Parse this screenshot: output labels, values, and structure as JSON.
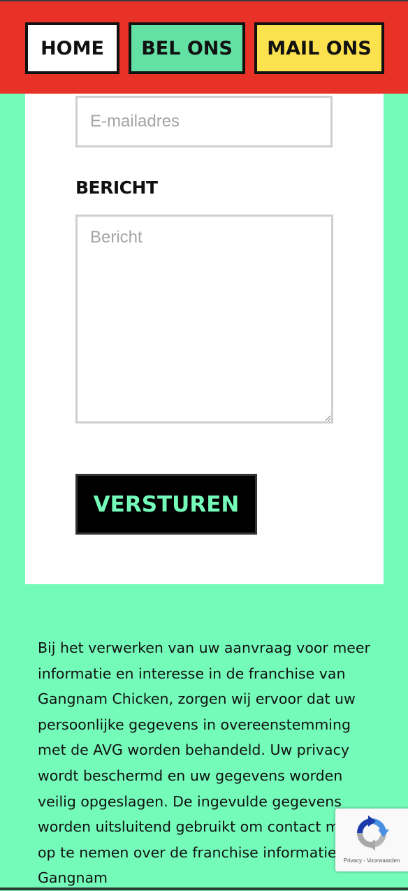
{
  "header": {
    "nav": [
      {
        "label": "HOME"
      },
      {
        "label": "BEL ONS"
      },
      {
        "label": "MAIL ONS"
      }
    ]
  },
  "form": {
    "email_placeholder": "E-mailadres",
    "message_label": "BERICHT",
    "message_placeholder": "Bericht",
    "submit_label": "VERSTUREN"
  },
  "privacy": {
    "text": "Bij het verwerken van uw aanvraag voor meer informatie en interesse in de franchise van Gangnam Chicken, zorgen wij ervoor dat uw persoonlijke gegevens in overeenstemming met de AVG worden behandeld. Uw privacy wordt beschermd en uw gegevens worden veilig opgeslagen. De ingevulde gegevens worden uitsluitend gebruikt om contact met u op te nemen over de franchise informatie van Gangnam"
  },
  "recaptcha": {
    "privacy_link": "Privacy",
    "separator": " - ",
    "terms_link": "Voorwaarden",
    "icon": "recaptcha-logo"
  },
  "colors": {
    "header_bg": "#e83227",
    "page_bg": "#74fbb9",
    "home_btn": "#ffffff",
    "bel_btn": "#63e0a4",
    "mail_btn": "#fde24f",
    "submit_bg": "#000000",
    "submit_text": "#74fbb9"
  }
}
